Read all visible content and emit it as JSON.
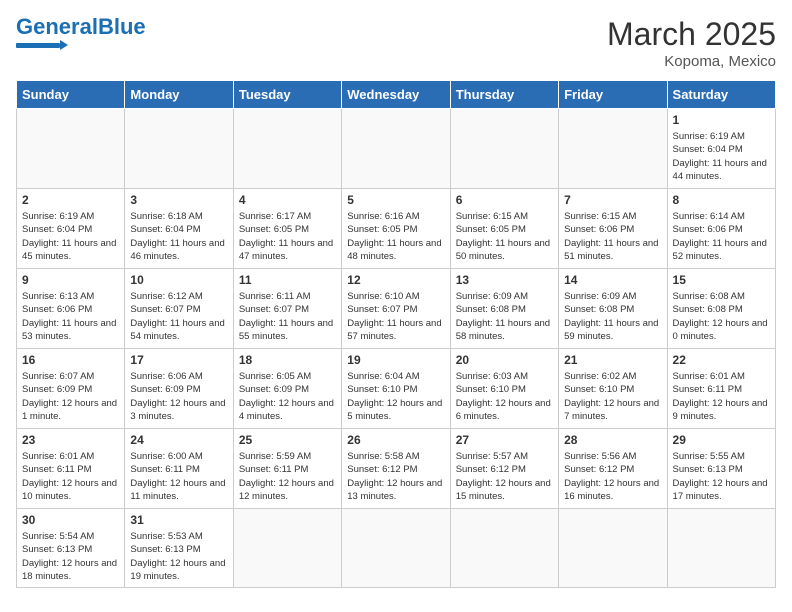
{
  "header": {
    "logo_general": "General",
    "logo_blue": "Blue",
    "month": "March 2025",
    "location": "Kopoma, Mexico"
  },
  "days_of_week": [
    "Sunday",
    "Monday",
    "Tuesday",
    "Wednesday",
    "Thursday",
    "Friday",
    "Saturday"
  ],
  "weeks": [
    [
      {
        "day": "",
        "info": ""
      },
      {
        "day": "",
        "info": ""
      },
      {
        "day": "",
        "info": ""
      },
      {
        "day": "",
        "info": ""
      },
      {
        "day": "",
        "info": ""
      },
      {
        "day": "",
        "info": ""
      },
      {
        "day": "1",
        "info": "Sunrise: 6:19 AM\nSunset: 6:04 PM\nDaylight: 11 hours\nand 44 minutes."
      }
    ],
    [
      {
        "day": "2",
        "info": "Sunrise: 6:19 AM\nSunset: 6:04 PM\nDaylight: 11 hours\nand 45 minutes."
      },
      {
        "day": "3",
        "info": "Sunrise: 6:18 AM\nSunset: 6:04 PM\nDaylight: 11 hours\nand 46 minutes."
      },
      {
        "day": "4",
        "info": "Sunrise: 6:17 AM\nSunset: 6:05 PM\nDaylight: 11 hours\nand 47 minutes."
      },
      {
        "day": "5",
        "info": "Sunrise: 6:16 AM\nSunset: 6:05 PM\nDaylight: 11 hours\nand 48 minutes."
      },
      {
        "day": "6",
        "info": "Sunrise: 6:15 AM\nSunset: 6:05 PM\nDaylight: 11 hours\nand 50 minutes."
      },
      {
        "day": "7",
        "info": "Sunrise: 6:15 AM\nSunset: 6:06 PM\nDaylight: 11 hours\nand 51 minutes."
      },
      {
        "day": "8",
        "info": "Sunrise: 6:14 AM\nSunset: 6:06 PM\nDaylight: 11 hours\nand 52 minutes."
      }
    ],
    [
      {
        "day": "9",
        "info": "Sunrise: 6:13 AM\nSunset: 6:06 PM\nDaylight: 11 hours\nand 53 minutes."
      },
      {
        "day": "10",
        "info": "Sunrise: 6:12 AM\nSunset: 6:07 PM\nDaylight: 11 hours\nand 54 minutes."
      },
      {
        "day": "11",
        "info": "Sunrise: 6:11 AM\nSunset: 6:07 PM\nDaylight: 11 hours\nand 55 minutes."
      },
      {
        "day": "12",
        "info": "Sunrise: 6:10 AM\nSunset: 6:07 PM\nDaylight: 11 hours\nand 57 minutes."
      },
      {
        "day": "13",
        "info": "Sunrise: 6:09 AM\nSunset: 6:08 PM\nDaylight: 11 hours\nand 58 minutes."
      },
      {
        "day": "14",
        "info": "Sunrise: 6:09 AM\nSunset: 6:08 PM\nDaylight: 11 hours\nand 59 minutes."
      },
      {
        "day": "15",
        "info": "Sunrise: 6:08 AM\nSunset: 6:08 PM\nDaylight: 12 hours\nand 0 minutes."
      }
    ],
    [
      {
        "day": "16",
        "info": "Sunrise: 6:07 AM\nSunset: 6:09 PM\nDaylight: 12 hours\nand 1 minute."
      },
      {
        "day": "17",
        "info": "Sunrise: 6:06 AM\nSunset: 6:09 PM\nDaylight: 12 hours\nand 3 minutes."
      },
      {
        "day": "18",
        "info": "Sunrise: 6:05 AM\nSunset: 6:09 PM\nDaylight: 12 hours\nand 4 minutes."
      },
      {
        "day": "19",
        "info": "Sunrise: 6:04 AM\nSunset: 6:10 PM\nDaylight: 12 hours\nand 5 minutes."
      },
      {
        "day": "20",
        "info": "Sunrise: 6:03 AM\nSunset: 6:10 PM\nDaylight: 12 hours\nand 6 minutes."
      },
      {
        "day": "21",
        "info": "Sunrise: 6:02 AM\nSunset: 6:10 PM\nDaylight: 12 hours\nand 7 minutes."
      },
      {
        "day": "22",
        "info": "Sunrise: 6:01 AM\nSunset: 6:11 PM\nDaylight: 12 hours\nand 9 minutes."
      }
    ],
    [
      {
        "day": "23",
        "info": "Sunrise: 6:01 AM\nSunset: 6:11 PM\nDaylight: 12 hours\nand 10 minutes."
      },
      {
        "day": "24",
        "info": "Sunrise: 6:00 AM\nSunset: 6:11 PM\nDaylight: 12 hours\nand 11 minutes."
      },
      {
        "day": "25",
        "info": "Sunrise: 5:59 AM\nSunset: 6:11 PM\nDaylight: 12 hours\nand 12 minutes."
      },
      {
        "day": "26",
        "info": "Sunrise: 5:58 AM\nSunset: 6:12 PM\nDaylight: 12 hours\nand 13 minutes."
      },
      {
        "day": "27",
        "info": "Sunrise: 5:57 AM\nSunset: 6:12 PM\nDaylight: 12 hours\nand 15 minutes."
      },
      {
        "day": "28",
        "info": "Sunrise: 5:56 AM\nSunset: 6:12 PM\nDaylight: 12 hours\nand 16 minutes."
      },
      {
        "day": "29",
        "info": "Sunrise: 5:55 AM\nSunset: 6:13 PM\nDaylight: 12 hours\nand 17 minutes."
      }
    ],
    [
      {
        "day": "30",
        "info": "Sunrise: 5:54 AM\nSunset: 6:13 PM\nDaylight: 12 hours\nand 18 minutes."
      },
      {
        "day": "31",
        "info": "Sunrise: 5:53 AM\nSunset: 6:13 PM\nDaylight: 12 hours\nand 19 minutes."
      },
      {
        "day": "",
        "info": ""
      },
      {
        "day": "",
        "info": ""
      },
      {
        "day": "",
        "info": ""
      },
      {
        "day": "",
        "info": ""
      },
      {
        "day": "",
        "info": ""
      }
    ]
  ]
}
